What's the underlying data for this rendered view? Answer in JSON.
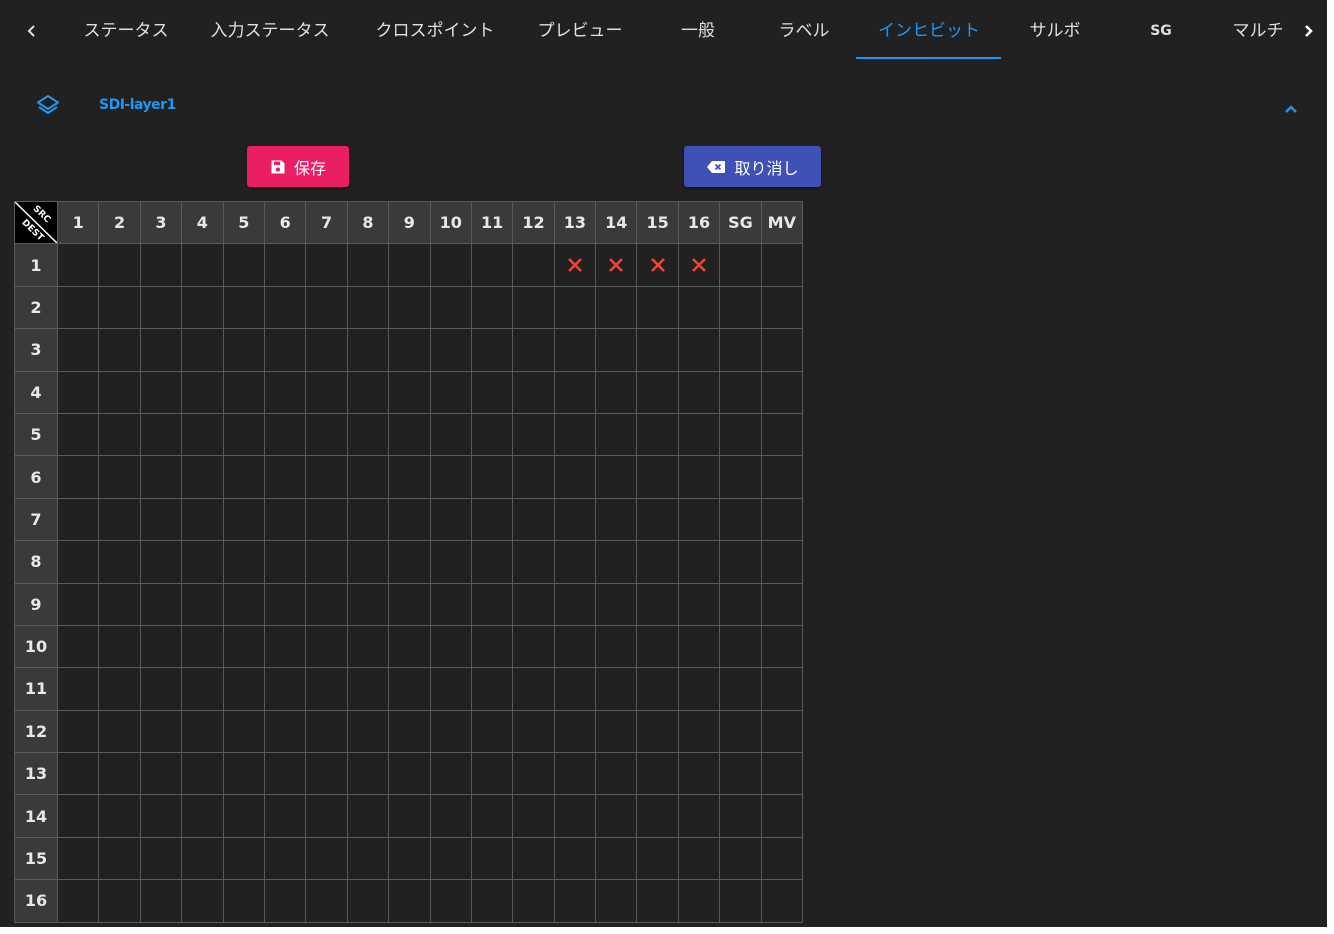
{
  "tabs": [
    {
      "label": "ステータス",
      "active": false
    },
    {
      "label": "入力ステータス",
      "active": false
    },
    {
      "label": "クロスポイント",
      "active": false
    },
    {
      "label": "プレビュー",
      "active": false
    },
    {
      "label": "一般",
      "active": false
    },
    {
      "label": "ラベル",
      "active": false
    },
    {
      "label": "インヒビット",
      "active": true
    },
    {
      "label": "サルボ",
      "active": false
    },
    {
      "label": "SG",
      "active": false
    },
    {
      "label": "マルチ",
      "active": false
    }
  ],
  "section": {
    "title": "SDI-layer1"
  },
  "buttons": {
    "save_label": "保存",
    "cancel_label": "取り消し"
  },
  "grid": {
    "corner_top": "SRC",
    "corner_bottom": "DEST",
    "columns": [
      "1",
      "2",
      "3",
      "4",
      "5",
      "6",
      "7",
      "8",
      "9",
      "10",
      "11",
      "12",
      "13",
      "14",
      "15",
      "16",
      "SG",
      "MV"
    ],
    "rows": [
      "1",
      "2",
      "3",
      "4",
      "5",
      "6",
      "7",
      "8",
      "9",
      "10",
      "11",
      "12",
      "13",
      "14",
      "15",
      "16"
    ],
    "inhibited": [
      {
        "row": "1",
        "col": "13"
      },
      {
        "row": "1",
        "col": "14"
      },
      {
        "row": "1",
        "col": "15"
      },
      {
        "row": "1",
        "col": "16"
      }
    ]
  },
  "colors": {
    "accent": "#2196f3",
    "save": "#e91e63",
    "cancel": "#3f51b5",
    "inhibit_mark": "#f44336",
    "background": "#212121"
  }
}
